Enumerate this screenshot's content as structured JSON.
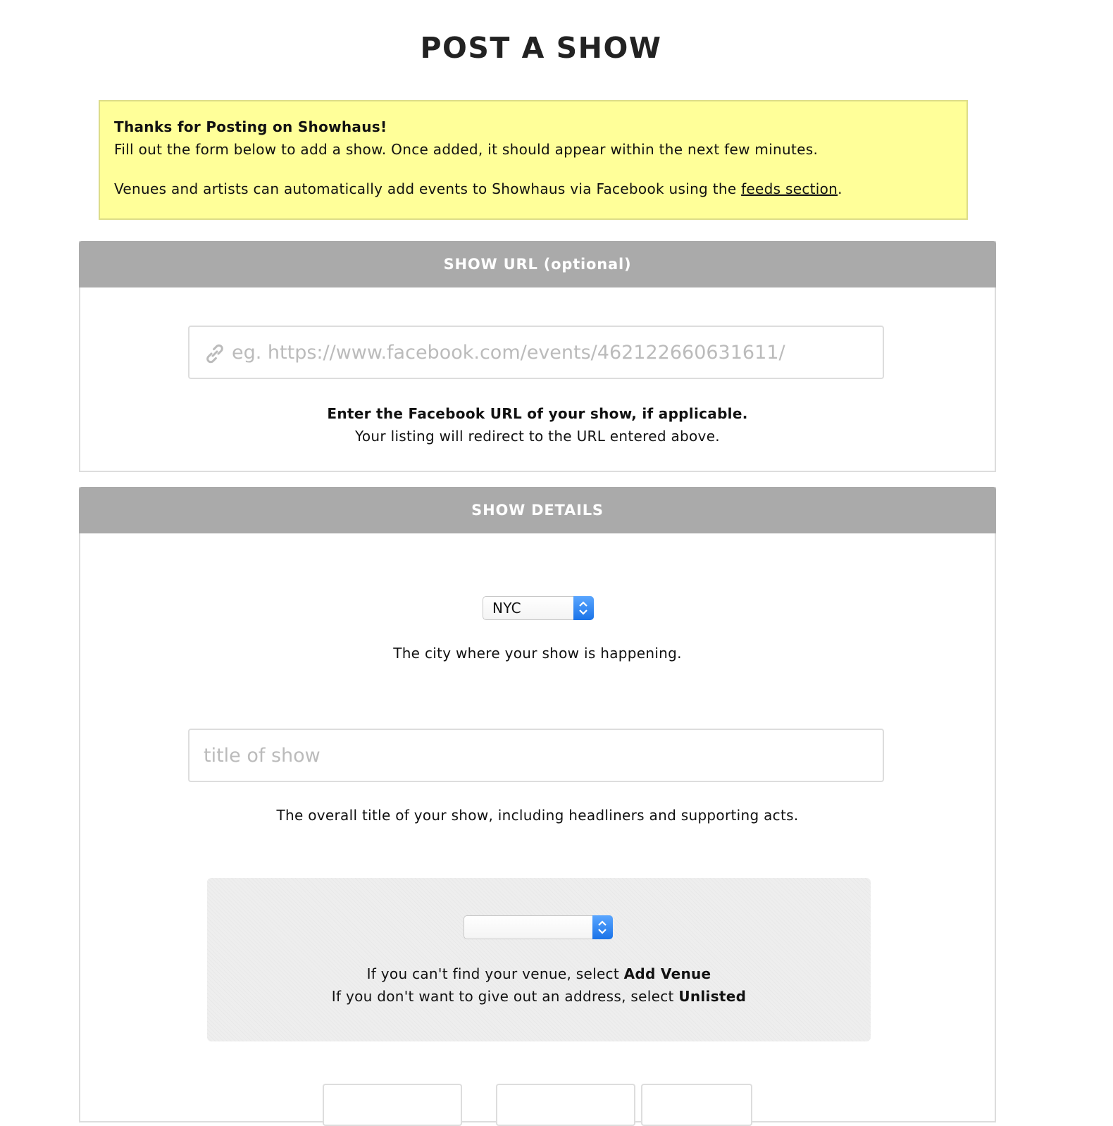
{
  "page": {
    "title": "POST A SHOW"
  },
  "notice": {
    "heading": "Thanks for Posting on Showhaus!",
    "line1": "Fill out the form below to add a show. Once added, it should appear within the next few minutes.",
    "line2_prefix": "Venues and artists can automatically add events to Showhaus via Facebook using the ",
    "line2_link": "feeds section",
    "line2_suffix": "."
  },
  "url_section": {
    "header": "SHOW URL (optional)",
    "input_placeholder": "eg. https://www.facebook.com/events/462122660631611/",
    "input_value": "",
    "help_strong": "Enter the Facebook URL of your show, if applicable.",
    "help_text": "Your listing will redirect to the URL entered above.",
    "icon": "link-icon"
  },
  "details_section": {
    "header": "SHOW DETAILS",
    "city_select": {
      "selected": "NYC",
      "help": "The city where your show is happening."
    },
    "title_input": {
      "placeholder": "title of show",
      "value": "",
      "help": "The overall title of your show, including headliners and supporting acts."
    },
    "venue": {
      "selected": "",
      "help1_prefix": "If you can't find your venue, select ",
      "help1_bold": "Add Venue",
      "help2_prefix": "If you don't want to give out an address, select ",
      "help2_bold": "Unlisted"
    }
  },
  "colors": {
    "notice_bg": "#ffff99",
    "section_header_bg": "#aaaaaa",
    "select_accent": "#1a73e8"
  }
}
